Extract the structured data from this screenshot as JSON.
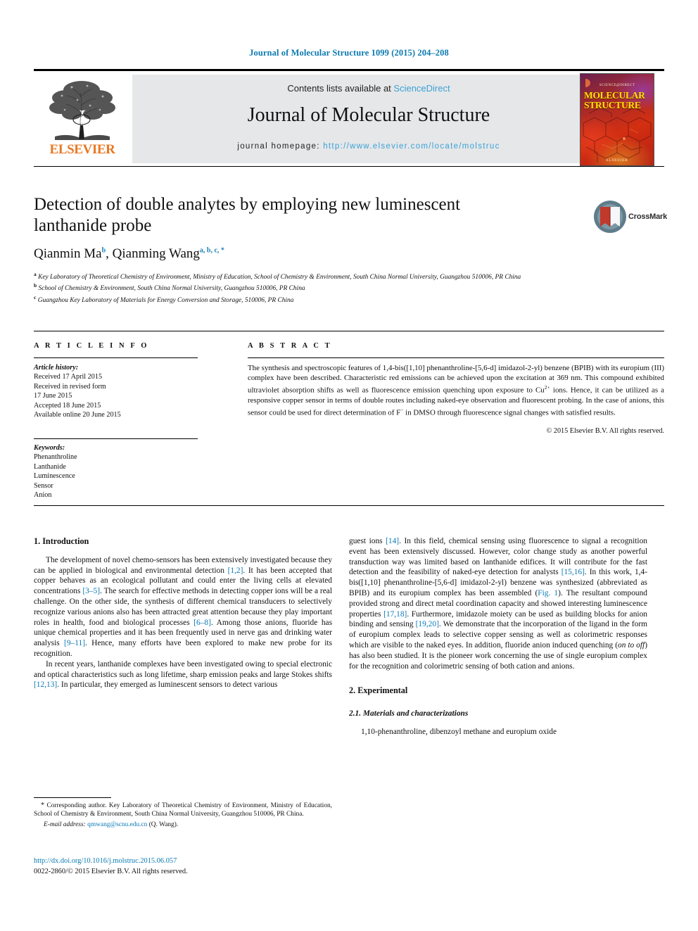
{
  "running_head": "Journal of Molecular Structure 1099 (2015) 204–208",
  "masthead": {
    "contents_prefix": "Contents lists available at ",
    "sciencedirect": "ScienceDirect",
    "journal_title": "Journal of Molecular Structure",
    "homepage_label": "journal homepage:",
    "homepage_url": "http://www.elsevier.com/locate/molstruc",
    "publisher_wordmark": "ELSEVIER",
    "cover": {
      "top_label": "SCIENCE@DIRECT",
      "title_line1": "MOLECULAR",
      "title_line2": "STRUCTURE",
      "publisher": "ELSEVIER"
    },
    "colors": {
      "link": "#3aa1d8",
      "elsevier_orange": "#e87722",
      "banner_gray": "#e6e7e8"
    }
  },
  "crossmark": {
    "label": "CrossMark"
  },
  "article": {
    "title": "Detection of double analytes by employing new luminescent lanthanide probe",
    "authors": [
      {
        "name": "Qianmin Ma",
        "marks": "b"
      },
      {
        "name": "Qianming Wang",
        "marks": "a, b, c, *"
      }
    ],
    "authors_plain": "Qianmin Ma b, Qianming Wang a, b, c, *",
    "affiliations": [
      {
        "mark": "a",
        "text": "Key Laboratory of Theoretical Chemistry of Environment, Ministry of Education, School of Chemistry & Environment, South China Normal University, Guangzhou 510006, PR China"
      },
      {
        "mark": "b",
        "text": "School of Chemistry & Environment, South China Normal University, Guangzhou 510006, PR China"
      },
      {
        "mark": "c",
        "text": "Guangzhou Key Laboratory of Materials for Energy Conversion and Storage, 510006, PR China"
      }
    ]
  },
  "article_info": {
    "heading": "A R T I C L E  I N F O",
    "history_label": "Article history:",
    "history": [
      "Received 17 April 2015",
      "Received in revised form",
      "17 June 2015",
      "Accepted 18 June 2015",
      "Available online 20 June 2015"
    ],
    "keywords_label": "Keywords:",
    "keywords": [
      "Phenanthroline",
      "Lanthanide",
      "Luminescence",
      "Sensor",
      "Anion"
    ]
  },
  "abstract": {
    "heading": "A B S T R A C T",
    "text_part1": "The synthesis and spectroscopic features of 1,4-bis([1,10] phenanthroline-[5,6-d] imidazol-2-yl) benzene (BPIB) with its europium (III) complex have been described. Characteristic red emissions can be achieved upon the excitation at 369 nm. This compound exhibited ultraviolet absorption shifts as well as fluorescence emission quenching upon exposure to Cu",
    "sup1": "2+",
    "text_part2": " ions. Hence, it can be utilized as a responsive copper sensor in terms of double routes including naked-eye observation and fluorescent probing. In the case of anions, this sensor could be used for direct determination of F",
    "sup2": "−",
    "text_part3": " in DMSO through fluorescence signal changes with satisfied results.",
    "copyright": "© 2015 Elsevier B.V. All rights reserved."
  },
  "body": {
    "section1_title": "1. Introduction",
    "left_p1_a": "The development of novel chemo-sensors has been extensively investigated because they can be applied in biological and environmental detection ",
    "left_p1_c1": "[1,2]",
    "left_p1_b": ". It has been accepted that copper behaves as an ecological pollutant and could enter the living cells at elevated concentrations ",
    "left_p1_c2": "[3–5]",
    "left_p1_c": ". The search for effective methods in detecting copper ions will be a real challenge. On the other side, the synthesis of different chemical transducers to selectively recognize various anions also has been attracted great attention because they play important roles in health, food and biological processes ",
    "left_p1_c3": "[6–8]",
    "left_p1_d": ". Among those anions, fluoride has unique chemical properties and it has been frequently used in nerve gas and drinking water analysis ",
    "left_p1_c4": "[9–11]",
    "left_p1_e": ". Hence, many efforts have been explored to make new probe for its recognition.",
    "left_p2_a": "In recent years, lanthanide complexes have been investigated owing to special electronic and optical characteristics such as long lifetime, sharp emission peaks and large Stokes shifts ",
    "left_p2_c1": "[12,13]",
    "left_p2_b": ". In particular, they emerged as luminescent sensors to detect various",
    "right_p1_a": "guest ions ",
    "right_p1_c1": "[14]",
    "right_p1_b": ". In this field, chemical sensing using fluorescence to signal a recognition event has been extensively discussed. However, color change study as another powerful transduction way was limited based on lanthanide edifices. It will contribute for the fast detection and the feasibility of naked-eye detection for analysts ",
    "right_p1_c2": "[15,16]",
    "right_p1_c": ". In this work, 1,4-bis([1,10] phenanthroline-[5,6-d] imidazol-2-yl) benzene was synthesized (abbreviated as BPIB) and its europium complex has been assembled (",
    "right_p1_fig": "Fig. 1",
    "right_p1_d": "). The resultant compound provided strong and direct metal coordination capacity and showed interesting luminescence properties ",
    "right_p1_c3": "[17,18]",
    "right_p1_e": ". Furthermore, imidazole moiety can be used as building blocks for anion binding and sensing ",
    "right_p1_c4": "[19,20]",
    "right_p1_f": ". We demonstrate that the incorporation of the ligand in the form of europium complex leads to selective copper sensing as well as colorimetric responses which are visible to the naked eyes. In addition, fluoride anion induced quenching (",
    "right_p1_ital": "on to off",
    "right_p1_g": ") has also been studied. It is the pioneer work concerning the use of single europium complex for the recognition and colorimetric sensing of both cation and anions.",
    "section2_title": "2. Experimental",
    "subsection21_title": "2.1. Materials and characterizations",
    "right_p2": "1,10-phenanthroline, dibenzoyl methane and europium oxide"
  },
  "footer": {
    "corresponding_star": "*",
    "corresponding_text": " Corresponding author. Key Laboratory of Theoretical Chemistry of Environment, Ministry of Education, School of Chemistry & Environment, South China Normal University, Guangzhou 510006, PR China.",
    "email_label": "E-mail address:",
    "email": "qmwang@scnu.edu.cn",
    "email_owner": "(Q. Wang).",
    "doi": "http://dx.doi.org/10.1016/j.molstruc.2015.06.057",
    "issn": "0022-2860/© 2015 Elsevier B.V. All rights reserved."
  }
}
